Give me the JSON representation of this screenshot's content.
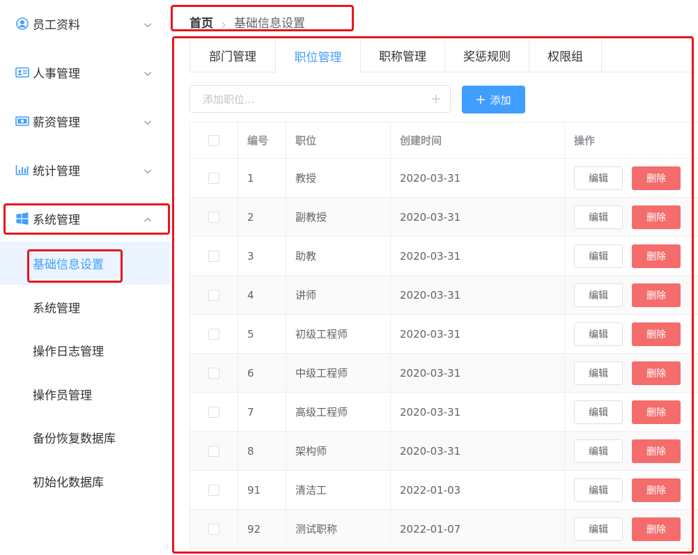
{
  "sidebar": {
    "menus": [
      {
        "label": "员工资料",
        "icon": "user-circle-icon"
      },
      {
        "label": "人事管理",
        "icon": "id-card-icon"
      },
      {
        "label": "薪资管理",
        "icon": "money-bill-icon"
      },
      {
        "label": "统计管理",
        "icon": "bar-chart-icon"
      },
      {
        "label": "系统管理",
        "icon": "windows-icon"
      }
    ],
    "submenu": [
      {
        "label": "基础信息设置"
      },
      {
        "label": "系统管理"
      },
      {
        "label": "操作日志管理"
      },
      {
        "label": "操作员管理"
      },
      {
        "label": "备份恢复数据库"
      },
      {
        "label": "初始化数据库"
      }
    ]
  },
  "breadcrumb": {
    "home": "首页",
    "current": "基础信息设置"
  },
  "tabs": [
    {
      "label": "部门管理"
    },
    {
      "label": "职位管理"
    },
    {
      "label": "职称管理"
    },
    {
      "label": "奖惩规则"
    },
    {
      "label": "权限组"
    }
  ],
  "add_bar": {
    "placeholder": "添加职位...",
    "button_label": "添加"
  },
  "table": {
    "headers": {
      "id": "编号",
      "name": "职位",
      "created": "创建时间",
      "ops": "操作"
    },
    "edit_label": "编辑",
    "delete_label": "删除",
    "rows": [
      {
        "id": "1",
        "name": "教授",
        "created": "2020-03-31"
      },
      {
        "id": "2",
        "name": "副教授",
        "created": "2020-03-31"
      },
      {
        "id": "3",
        "name": "助教",
        "created": "2020-03-31"
      },
      {
        "id": "4",
        "name": "讲师",
        "created": "2020-03-31"
      },
      {
        "id": "5",
        "name": "初级工程师",
        "created": "2020-03-31"
      },
      {
        "id": "6",
        "name": "中级工程师",
        "created": "2020-03-31"
      },
      {
        "id": "7",
        "name": "高级工程师",
        "created": "2020-03-31"
      },
      {
        "id": "8",
        "name": "架构师",
        "created": "2020-03-31"
      },
      {
        "id": "91",
        "name": "清洁工",
        "created": "2022-01-03"
      },
      {
        "id": "92",
        "name": "测试职称",
        "created": "2022-01-07"
      }
    ]
  },
  "colors": {
    "primary": "#409eff",
    "danger": "#f56c6c",
    "highlight": "#e8141b"
  }
}
